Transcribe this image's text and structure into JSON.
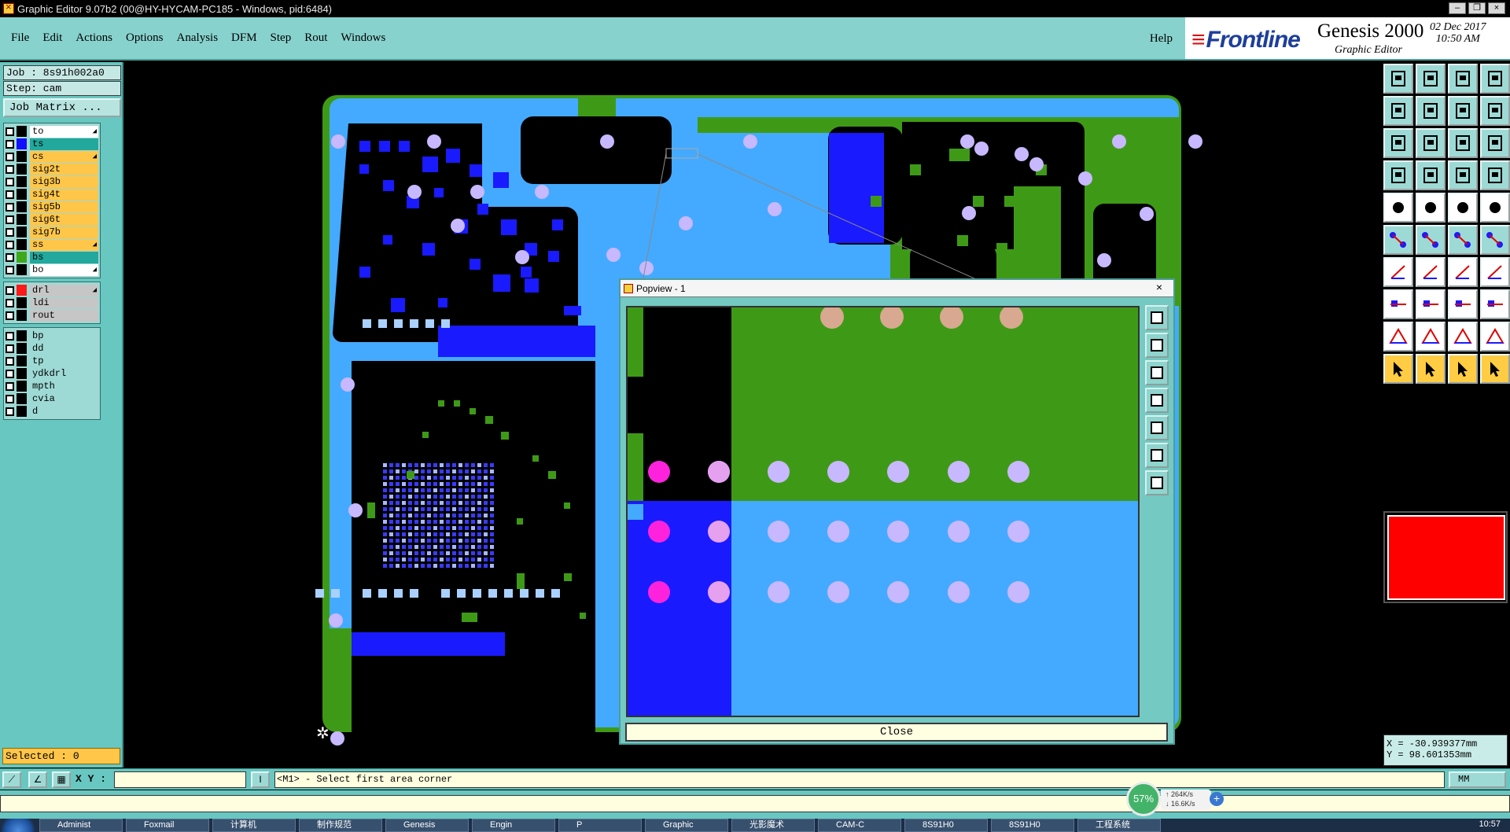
{
  "window": {
    "title": "Graphic Editor 9.07b2 (00@HY-HYCAM-PC185 - Windows, pid:6484)",
    "controls": [
      "–",
      "❐",
      "×"
    ]
  },
  "menu": {
    "items": [
      "File",
      "Edit",
      "Actions",
      "Options",
      "Analysis",
      "DFM",
      "Step",
      "Rout",
      "Windows"
    ],
    "help": "Help"
  },
  "brand": {
    "logo": "Frontline",
    "product": "Genesis 2000",
    "subtitle": "Graphic Editor",
    "date": "02 Dec 2017",
    "time": "10:50 AM"
  },
  "job": {
    "job_line": "Job : 8s91h002a0",
    "step_line": "Step: cam",
    "matrix_button": "Job Matrix ..."
  },
  "layers": {
    "group1": [
      {
        "name": "to",
        "bg": "#ffffff",
        "swatch": "#000000",
        "mark": true
      },
      {
        "name": "ts",
        "bg": "#22a89d",
        "swatch": "#1010ff",
        "mark": false
      },
      {
        "name": "cs",
        "bg": "#ffc64a",
        "swatch": "#000000",
        "mark": true
      },
      {
        "name": "sig2t",
        "bg": "#ffc64a",
        "swatch": "#000000",
        "mark": false
      },
      {
        "name": "sig3b",
        "bg": "#ffc64a",
        "swatch": "#000000",
        "mark": false
      },
      {
        "name": "sig4t",
        "bg": "#ffc64a",
        "swatch": "#000000",
        "mark": false
      },
      {
        "name": "sig5b",
        "bg": "#ffc64a",
        "swatch": "#000000",
        "mark": false
      },
      {
        "name": "sig6t",
        "bg": "#ffc64a",
        "swatch": "#000000",
        "mark": false
      },
      {
        "name": "sig7b",
        "bg": "#ffc64a",
        "swatch": "#000000",
        "mark": false
      },
      {
        "name": "ss",
        "bg": "#ffc64a",
        "swatch": "#000000",
        "mark": true
      },
      {
        "name": "bs",
        "bg": "#22a89d",
        "swatch": "#3fa81a",
        "mark": false
      },
      {
        "name": "bo",
        "bg": "#ffffff",
        "swatch": "#000000",
        "mark": true
      }
    ],
    "group2": [
      {
        "name": "drl",
        "bg": "#c6c6c6",
        "swatch": "#ff1a1a",
        "mark": true
      },
      {
        "name": "ldi",
        "bg": "#c6c6c6",
        "swatch": "#000000",
        "mark": false
      },
      {
        "name": "rout",
        "bg": "#c6c6c6",
        "swatch": "#000000",
        "mark": false
      }
    ],
    "group3": [
      {
        "name": "bp",
        "bg": "#9edad5",
        "swatch": "#000000",
        "mark": false
      },
      {
        "name": "dd",
        "bg": "#9edad5",
        "swatch": "#000000",
        "mark": false
      },
      {
        "name": "tp",
        "bg": "#9edad5",
        "swatch": "#000000",
        "mark": false
      },
      {
        "name": "ydkdrl",
        "bg": "#9edad5",
        "swatch": "#000000",
        "mark": false
      },
      {
        "name": "mpth",
        "bg": "#9edad5",
        "swatch": "#000000",
        "mark": false
      },
      {
        "name": "cvia",
        "bg": "#9edad5",
        "swatch": "#000000",
        "mark": false
      },
      {
        "name": "d",
        "bg": "#9edad5",
        "swatch": "#000000",
        "mark": false
      }
    ]
  },
  "selected": "Selected : 0",
  "popview": {
    "title": "Popview - 1",
    "close_icon": "×",
    "close_button": "Close"
  },
  "command": {
    "xy_label": "X Y :",
    "xy_value": "",
    "prompt": "<M1> - Select first area corner",
    "units": "MM"
  },
  "coords": {
    "x": "X = -30.939377mm",
    "y": "Y = 98.601353mm"
  },
  "network": {
    "percent": "57%",
    "up": "↑ 264K/s",
    "down": "↓ 16.6K/s"
  },
  "taskbar": {
    "tasks": [
      "Administ",
      "Foxmail",
      "计算机",
      "制作规范",
      "Genesis",
      "Engin",
      "P",
      "Graphic",
      "光影魔术",
      "CAM-C",
      "8S91H0",
      "8S91H0",
      "工程系统"
    ],
    "clock": "10:57"
  },
  "colors": {
    "panel": "#68c7c0",
    "board_green": "#3e9a16",
    "board_blue": "#44aaff",
    "pad_blue": "#1a1aff",
    "drill_magenta": "#ff22dd",
    "via_lilac": "#c8b8ff"
  }
}
